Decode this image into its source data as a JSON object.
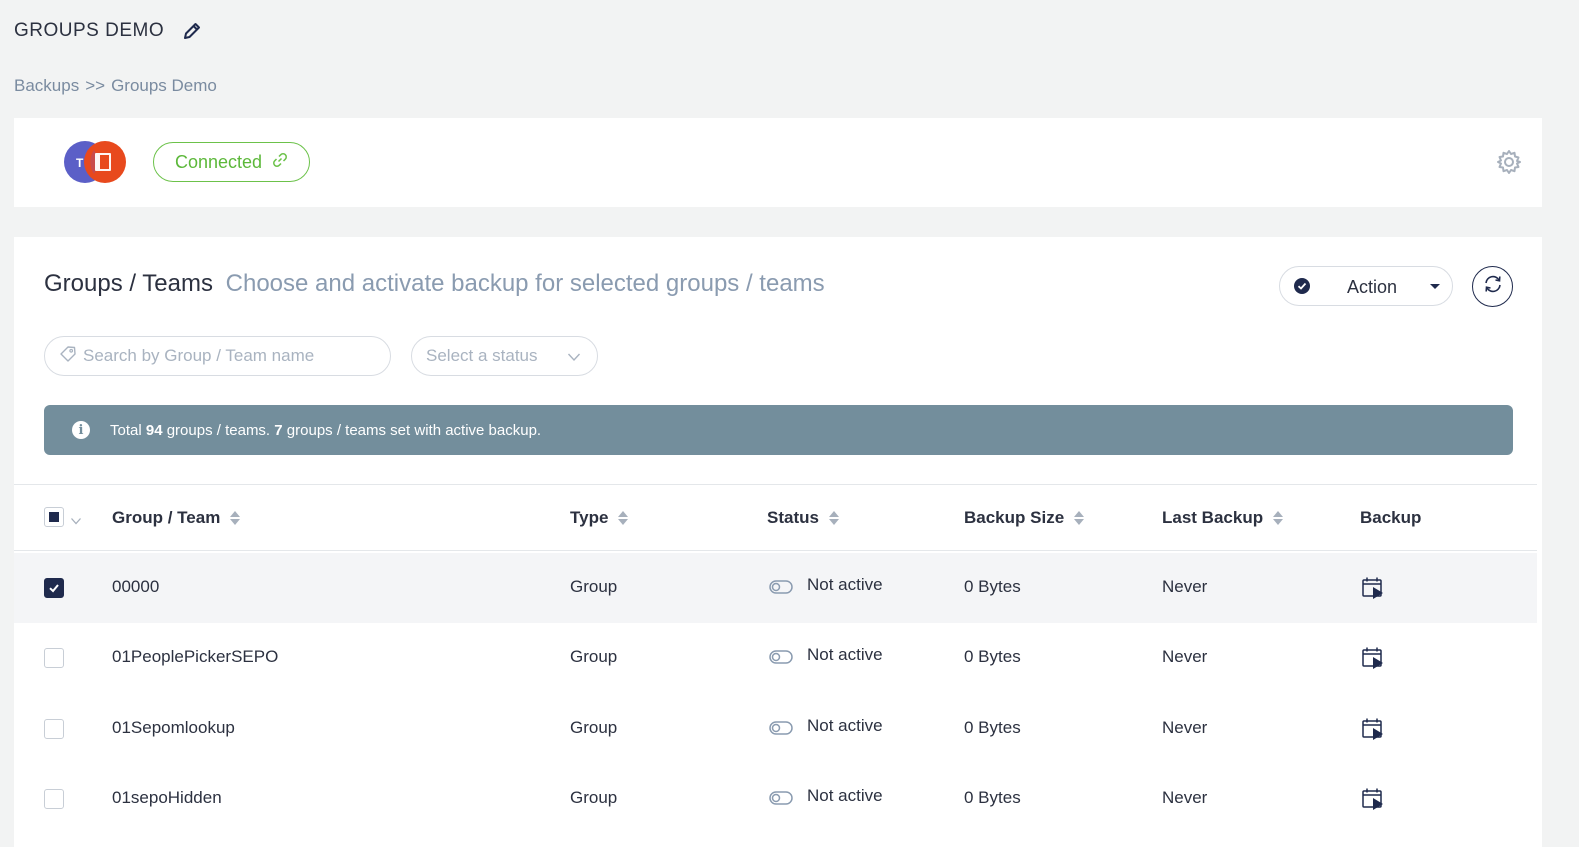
{
  "page": {
    "title": "GROUPS DEMO"
  },
  "breadcrumb": {
    "root": "Backups",
    "separator": ">>",
    "current": "Groups Demo"
  },
  "connection": {
    "status_label": "Connected",
    "status_color": "#5cb83a"
  },
  "section": {
    "title": "Groups / Teams",
    "subtitle": "Choose and activate backup for selected groups / teams"
  },
  "toolbar": {
    "action_label": "Action"
  },
  "filters": {
    "search_placeholder": "Search by Group / Team name",
    "status_placeholder": "Select a status"
  },
  "info": {
    "prefix": "Total",
    "total": "94",
    "middle": "groups / teams.",
    "active": "7",
    "suffix": "groups / teams set with active backup."
  },
  "table": {
    "columns": [
      "Group / Team",
      "Type",
      "Status",
      "Backup Size",
      "Last Backup",
      "Backup"
    ],
    "rows": [
      {
        "name": "00000",
        "type": "Group",
        "status": "Not active",
        "size": "0 Bytes",
        "last": "Never",
        "checked": true
      },
      {
        "name": "01PeoplePickerSEPO",
        "type": "Group",
        "status": "Not active",
        "size": "0 Bytes",
        "last": "Never",
        "checked": false
      },
      {
        "name": "01Sepomlookup",
        "type": "Group",
        "status": "Not active",
        "size": "0 Bytes",
        "last": "Never",
        "checked": false
      },
      {
        "name": "01sepoHidden",
        "type": "Group",
        "status": "Not active",
        "size": "0 Bytes",
        "last": "Never",
        "checked": false
      }
    ]
  },
  "icons": {
    "edit": "pencil-icon",
    "settings": "gear-icon",
    "refresh": "refresh-icon",
    "search": "tag-icon",
    "info": "info-icon",
    "status": "toggle-off-icon",
    "backup": "calendar-play-icon"
  },
  "colors": {
    "accent": "#1f2a4d",
    "info_bar": "#738e9c",
    "connected": "#6cc24a",
    "teams": "#5b5fc7",
    "office": "#e8491d"
  }
}
